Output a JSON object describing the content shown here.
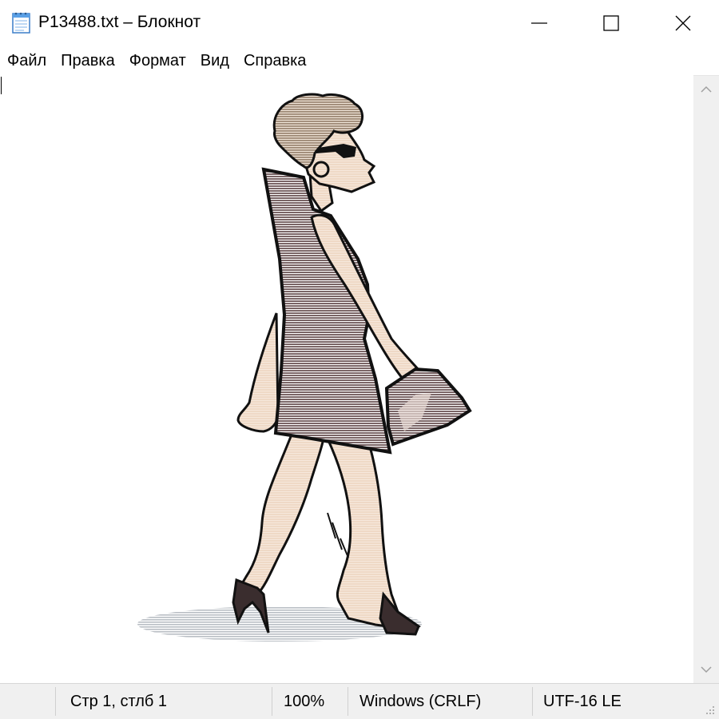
{
  "window": {
    "title": "P13488.txt – Блокнот",
    "icon": "notepad-icon",
    "controls": {
      "minimize": "minimize-icon",
      "maximize": "maximize-icon",
      "close": "close-icon"
    }
  },
  "menu": [
    {
      "label": "Файл"
    },
    {
      "label": "Правка"
    },
    {
      "label": "Формат"
    },
    {
      "label": "Вид"
    },
    {
      "label": "Справка"
    }
  ],
  "editor": {
    "content": "ascii-art-walking-woman-illustration"
  },
  "status": {
    "position": "Стр 1, стлб 1",
    "zoom": "100%",
    "line_endings": "Windows (CRLF)",
    "encoding": "UTF-16 LE"
  },
  "colors": {
    "dress": "#7a6566",
    "skin": "#efd9c6",
    "hair": "#9d8875",
    "outline": "#111111",
    "shadow": "#b9bec4"
  }
}
